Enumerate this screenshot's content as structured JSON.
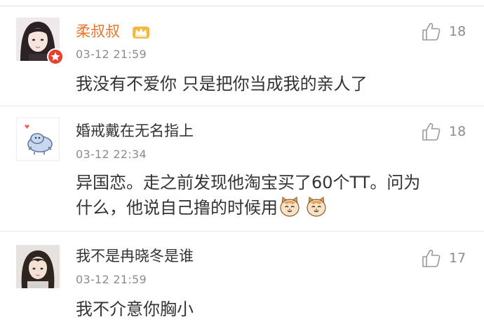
{
  "comments": [
    {
      "username": "柔叔叔",
      "time": "03-12 21:59",
      "text": "我没有不爱你 只是把你当成我的亲人了",
      "likes": "18",
      "avatar": "girl-photo-avatar",
      "badge": "verified-star-badge",
      "vip_icon": "crown-icon",
      "username_color": "#e8762c"
    },
    {
      "username": "婚戒戴在无名指上",
      "time": "03-12 22:34",
      "text_line1": "异国恋。走之前发现他淘宝买了60个TT。问为",
      "text_line2": "什么，他说自己撸的时候用",
      "emojis": [
        "cat-face-emoji",
        "cat-face-emoji"
      ],
      "likes": "18",
      "avatar": "cartoon-bird-avatar"
    },
    {
      "username": "我不是冉晓冬是谁",
      "time": "03-12 21:59",
      "text": "我不介意你胸小",
      "likes": "17",
      "avatar": "girl-photo-avatar"
    }
  ],
  "colors": {
    "text": "#333333",
    "meta": "#8c8c8c",
    "vip_name": "#e8762c",
    "divider": "#e6e6e6",
    "badge_red": "#e8402f"
  }
}
